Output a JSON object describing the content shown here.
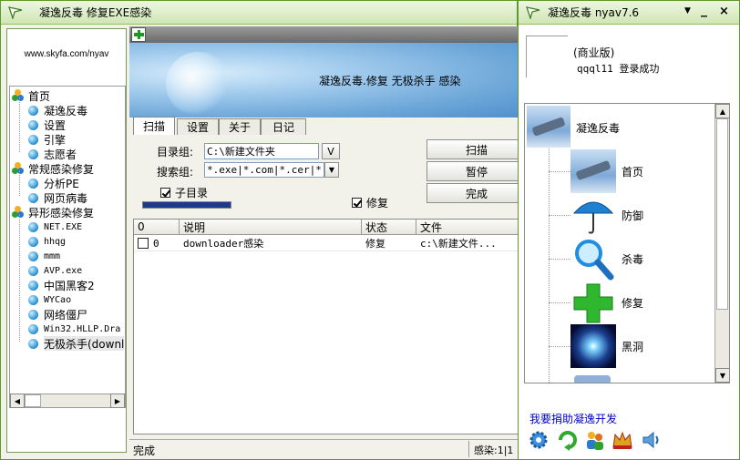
{
  "left_window": {
    "title": "凝逸反毒 修复EXE感染",
    "url": "www.skyfa.com/nyav",
    "tree": [
      {
        "label": "首页",
        "level": 0,
        "icon": "group-icon"
      },
      {
        "label": "凝逸反毒",
        "level": 1,
        "icon": "dot-icon"
      },
      {
        "label": "设置",
        "level": 1,
        "icon": "dot-icon"
      },
      {
        "label": "引擎",
        "level": 1,
        "icon": "dot-icon"
      },
      {
        "label": "志愿者",
        "level": 1,
        "icon": "dot-icon"
      },
      {
        "label": "常规感染修复",
        "level": 0,
        "icon": "group-icon"
      },
      {
        "label": "分析PE",
        "level": 1,
        "icon": "dot-icon"
      },
      {
        "label": "网页病毒",
        "level": 1,
        "icon": "dot-icon"
      },
      {
        "label": "异形感染修复",
        "level": 0,
        "icon": "group-icon"
      },
      {
        "label": "NET.EXE",
        "level": 1,
        "icon": "dot-icon"
      },
      {
        "label": "hhqg",
        "level": 1,
        "icon": "dot-icon"
      },
      {
        "label": "mmm",
        "level": 1,
        "icon": "dot-icon"
      },
      {
        "label": "AVP.exe",
        "level": 1,
        "icon": "dot-icon"
      },
      {
        "label": "中国黑客2",
        "level": 1,
        "icon": "dot-icon"
      },
      {
        "label": "WYCao",
        "level": 1,
        "icon": "dot-icon"
      },
      {
        "label": "网络僵尸",
        "level": 1,
        "icon": "dot-icon"
      },
      {
        "label": "Win32.HLLP.Dra",
        "level": 1,
        "icon": "dot-icon"
      },
      {
        "label": "无极杀手(downl",
        "level": 1,
        "icon": "dot-icon",
        "selected": true
      }
    ],
    "banner_text": "凝逸反毒.修复 无极杀手 感染",
    "tabs": [
      "扫描",
      "设置",
      "关于",
      "日记"
    ],
    "dir_group_label": "目录组:",
    "dir_group_value": "C:\\新建文件夹",
    "dir_btn": "V",
    "search_group_label": "搜索组:",
    "search_group_value": "*.exe|*.com|*.cer|*.c",
    "subdir_label": "子目录",
    "repair_label": "修复",
    "scan_btn": "扫描",
    "pause_btn": "暂停",
    "done_btn": "完成",
    "columns": [
      "0",
      "说明",
      "状态",
      "文件"
    ],
    "rows": [
      {
        "num": "0",
        "desc": "downloader感染",
        "status": "修复",
        "file": "c:\\新建文件..."
      }
    ],
    "status_left": "完成",
    "status_right": "感染:1|1"
  },
  "right_window": {
    "title": "凝逸反毒 nyav7.6",
    "edition": "(商业版)",
    "login": "qqql11 登录成功",
    "menu": [
      {
        "label": "凝逸反毒",
        "icon": "satellite-icon"
      },
      {
        "label": "首页",
        "icon": "satellite-icon"
      },
      {
        "label": "防御",
        "icon": "umbrella-icon"
      },
      {
        "label": "杀毒",
        "icon": "magnifier-icon"
      },
      {
        "label": "修复",
        "icon": "plus-icon"
      },
      {
        "label": "黑洞",
        "icon": "blackhole-icon"
      }
    ],
    "donate": "我要捐助凝逸开发"
  },
  "colors": {
    "accent": "#5c9a2c",
    "link": "#0000cc",
    "progress": "#1c3a8c"
  }
}
